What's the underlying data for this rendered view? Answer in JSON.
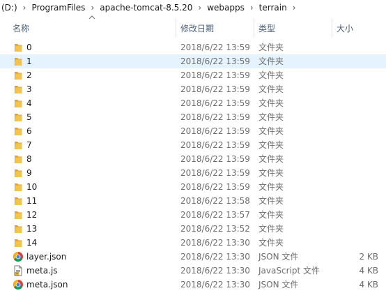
{
  "breadcrumb": {
    "items": [
      "(D:)",
      "ProgramFiles",
      "apache-tomcat-8.5.20",
      "webapps",
      "terrain"
    ],
    "separator": "›"
  },
  "columns": {
    "name": "名称",
    "modified": "修改日期",
    "type": "类型",
    "size": "大小"
  },
  "colors": {
    "selected_row": "#e5f3ff",
    "folder": "#f3c44e",
    "header_text": "#4c607a"
  },
  "files": [
    {
      "name": "0",
      "modified": "2018/6/22 13:59",
      "type": "文件夹",
      "size": "",
      "icon": "folder-icon",
      "selected": false
    },
    {
      "name": "1",
      "modified": "2018/6/22 13:59",
      "type": "文件夹",
      "size": "",
      "icon": "folder-icon",
      "selected": true
    },
    {
      "name": "2",
      "modified": "2018/6/22 13:59",
      "type": "文件夹",
      "size": "",
      "icon": "folder-icon",
      "selected": false
    },
    {
      "name": "3",
      "modified": "2018/6/22 13:59",
      "type": "文件夹",
      "size": "",
      "icon": "folder-icon",
      "selected": false
    },
    {
      "name": "4",
      "modified": "2018/6/22 13:59",
      "type": "文件夹",
      "size": "",
      "icon": "folder-icon",
      "selected": false
    },
    {
      "name": "5",
      "modified": "2018/6/22 13:59",
      "type": "文件夹",
      "size": "",
      "icon": "folder-icon",
      "selected": false
    },
    {
      "name": "6",
      "modified": "2018/6/22 13:59",
      "type": "文件夹",
      "size": "",
      "icon": "folder-icon",
      "selected": false
    },
    {
      "name": "7",
      "modified": "2018/6/22 13:59",
      "type": "文件夹",
      "size": "",
      "icon": "folder-icon",
      "selected": false
    },
    {
      "name": "8",
      "modified": "2018/6/22 13:59",
      "type": "文件夹",
      "size": "",
      "icon": "folder-icon",
      "selected": false
    },
    {
      "name": "9",
      "modified": "2018/6/22 13:59",
      "type": "文件夹",
      "size": "",
      "icon": "folder-icon",
      "selected": false
    },
    {
      "name": "10",
      "modified": "2018/6/22 13:59",
      "type": "文件夹",
      "size": "",
      "icon": "folder-icon",
      "selected": false
    },
    {
      "name": "11",
      "modified": "2018/6/22 13:58",
      "type": "文件夹",
      "size": "",
      "icon": "folder-icon",
      "selected": false
    },
    {
      "name": "12",
      "modified": "2018/6/22 13:57",
      "type": "文件夹",
      "size": "",
      "icon": "folder-icon",
      "selected": false
    },
    {
      "name": "13",
      "modified": "2018/6/22 13:52",
      "type": "文件夹",
      "size": "",
      "icon": "folder-icon",
      "selected": false
    },
    {
      "name": "14",
      "modified": "2018/6/22 13:30",
      "type": "文件夹",
      "size": "",
      "icon": "folder-icon",
      "selected": false
    },
    {
      "name": "layer.json",
      "modified": "2018/6/22 13:30",
      "type": "JSON 文件",
      "size": "2 KB",
      "icon": "chrome-icon",
      "selected": false
    },
    {
      "name": "meta.js",
      "modified": "2018/6/22 13:30",
      "type": "JavaScript 文件",
      "size": "4 KB",
      "icon": "script-file-icon",
      "selected": false
    },
    {
      "name": "meta.json",
      "modified": "2018/6/22 13:30",
      "type": "JSON 文件",
      "size": "4 KB",
      "icon": "chrome-icon",
      "selected": false
    }
  ]
}
